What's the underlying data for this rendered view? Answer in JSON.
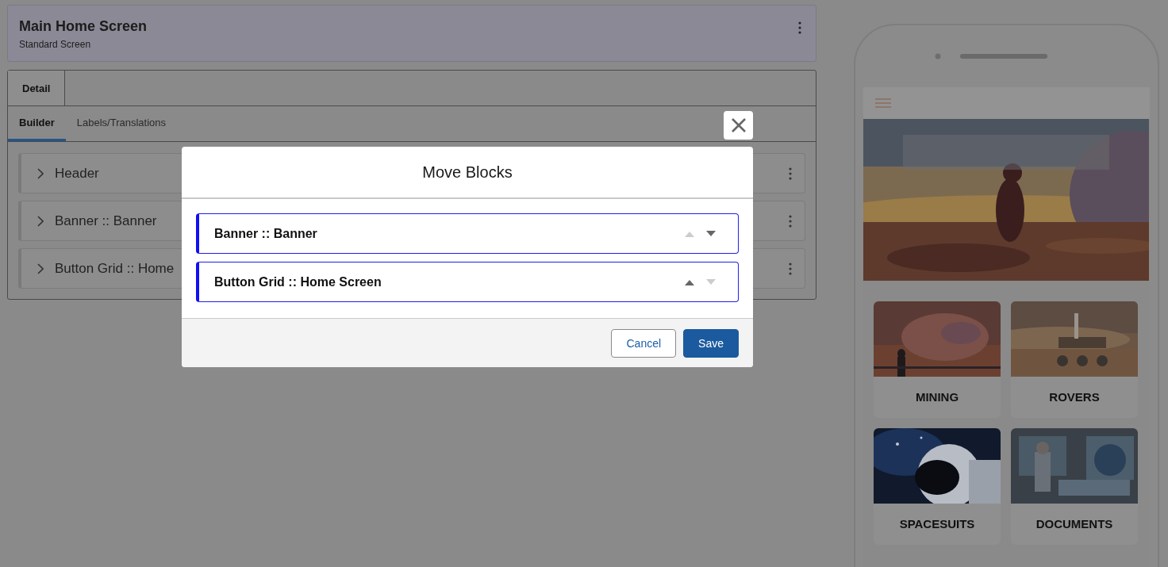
{
  "header": {
    "title": "Main Home Screen",
    "subtitle": "Standard Screen"
  },
  "tabs": [
    {
      "label": "Detail",
      "selected": true
    }
  ],
  "subtabs": [
    {
      "label": "Builder",
      "selected": true
    },
    {
      "label": "Labels/Translations",
      "selected": false
    }
  ],
  "blocks": [
    {
      "label": "Header"
    },
    {
      "label": "Banner :: Banner"
    },
    {
      "label": "Button Grid :: Home"
    }
  ],
  "modal": {
    "title": "Move Blocks",
    "items": [
      {
        "label": "Banner :: Banner",
        "can_move_up": false,
        "can_move_down": true
      },
      {
        "label": "Button Grid :: Home Screen",
        "can_move_up": true,
        "can_move_down": false
      }
    ],
    "buttons": [
      {
        "label": "Cancel",
        "kind": "neutral"
      },
      {
        "label": "Save",
        "kind": "brand"
      }
    ]
  },
  "preview": {
    "tiles": [
      {
        "label": "MINING",
        "kind": "picture"
      },
      {
        "label": "ROVERS",
        "kind": "picture"
      },
      {
        "label": "SPACESUITS",
        "kind": "picture"
      },
      {
        "label": "DOCUMENTS",
        "kind": "picture"
      }
    ]
  }
}
